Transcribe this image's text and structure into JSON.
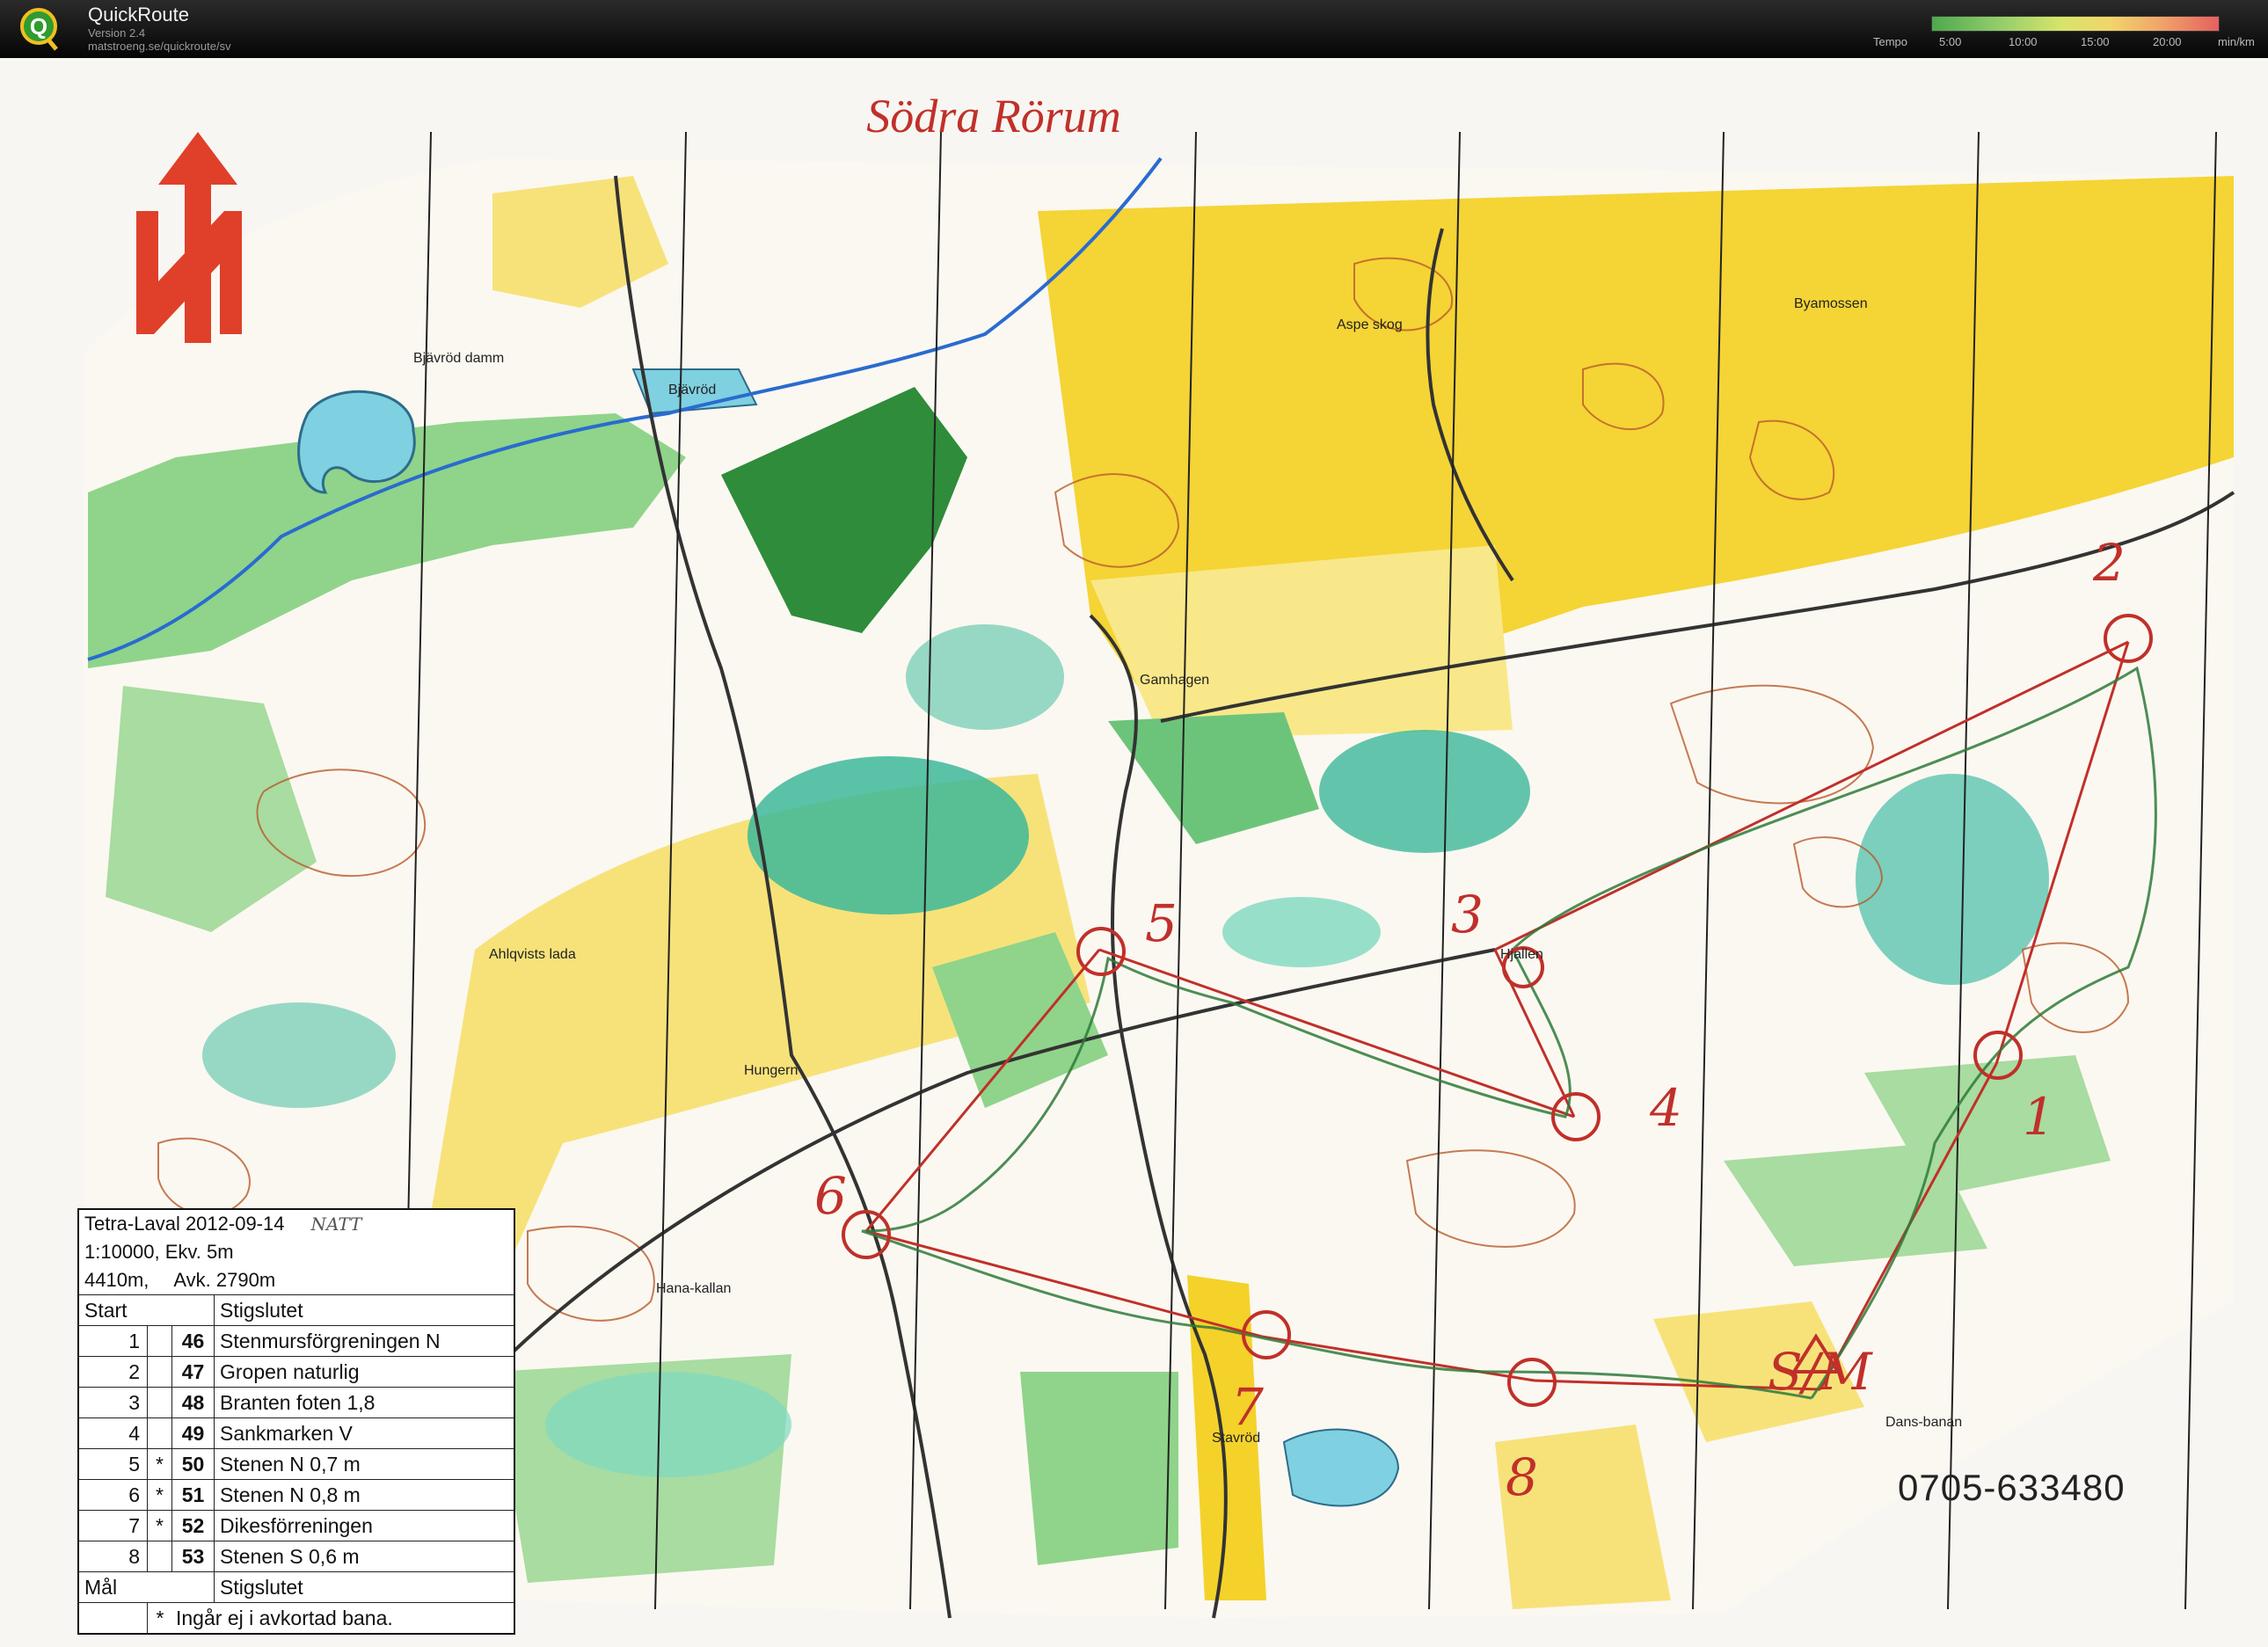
{
  "app": {
    "name": "QuickRoute",
    "version": "Version 2.4",
    "url": "matstroeng.se/quickroute/sv"
  },
  "tempo_legend": {
    "label": "Tempo",
    "ticks": [
      "5:00",
      "10:00",
      "15:00",
      "20:00"
    ],
    "unit": "min/km",
    "colors": [
      "#4ea84e",
      "#8fcb6a",
      "#d7e46a",
      "#f1d56a",
      "#f0a46a",
      "#e66060"
    ]
  },
  "map": {
    "title": "Södra Rörum",
    "phone": "0705-633480",
    "place_names": [
      "Bjävröd",
      "Bjävröd damm",
      "Aspe skog",
      "Byamossen",
      "Gamhagen",
      "Ahlqvists lada",
      "Hungern",
      "Hana-kallan",
      "Stavröd",
      "Hjallen",
      "Dans-banan"
    ],
    "handwritten": [
      "2",
      "3",
      "4",
      "5",
      "6",
      "7",
      "8",
      "S/M",
      "1",
      "NATT"
    ],
    "colors": {
      "open_land": "#f7e27a",
      "field": "#f4d22a",
      "green_light": "#a8dca0",
      "green_dark": "#2e8c3a",
      "marsh": "#3cb89a",
      "water": "#7fd0e0",
      "contour": "#b85a2a",
      "course": "#c0302a",
      "route": "#2e7a3a",
      "north_lines": "#222222"
    }
  },
  "control_card": {
    "event": "Tetra-Laval 2012-09-14",
    "note": "NATT",
    "scale": "1:10000, Ekv. 5m",
    "length": "4410m,",
    "climb": "Avk. 2790m",
    "start_label": "Start",
    "start_desc": "Stigslutet",
    "controls": [
      {
        "num": "1",
        "star": "",
        "code": "46",
        "desc": "Stenmursförgreningen N"
      },
      {
        "num": "2",
        "star": "",
        "code": "47",
        "desc": "Gropen naturlig"
      },
      {
        "num": "3",
        "star": "",
        "code": "48",
        "desc": "Branten foten 1,8"
      },
      {
        "num": "4",
        "star": "",
        "code": "49",
        "desc": "Sankmarken V"
      },
      {
        "num": "5",
        "star": "*",
        "code": "50",
        "desc": "Stenen N  0,7 m"
      },
      {
        "num": "6",
        "star": "*",
        "code": "51",
        "desc": "Stenen N  0,8 m"
      },
      {
        "num": "7",
        "star": "*",
        "code": "52",
        "desc": "Dikesförreningen"
      },
      {
        "num": "8",
        "star": "",
        "code": "53",
        "desc": "Stenen S  0,6 m"
      }
    ],
    "finish_label": "Mål",
    "finish_desc": "Stigslutet",
    "footnote_star": "*",
    "footnote": "Ingår ej i avkortad bana."
  }
}
